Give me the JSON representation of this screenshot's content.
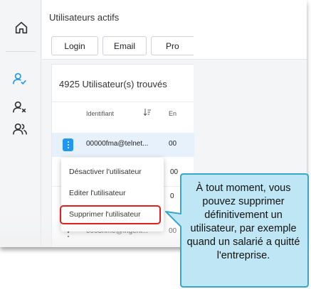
{
  "header": {
    "title": "Utilisateurs actifs",
    "buttons": {
      "login": "Login",
      "email": "Email",
      "pro": "Pro"
    }
  },
  "results": {
    "count_label": "4925 Utilisateur(s) trouvés"
  },
  "table": {
    "columns": {
      "identifiant": "Identifiant",
      "en": "En"
    },
    "rows": [
      {
        "id": "00000fma@telnet...",
        "col2": "00"
      },
      {
        "id": "",
        "col2": "00"
      },
      {
        "id": "",
        "col2": "0"
      },
      {
        "id": "0003hme@ingeni...",
        "col2": "00"
      }
    ]
  },
  "context_menu": {
    "deactivate": "Désactiver l'utilisateur",
    "edit": "Editer l'utilisateur",
    "delete": "Supprimer l'utilisateur"
  },
  "callout": {
    "text": "À tout moment, vous pouvez supprimer définitivement un utilisateur, par exemple quand un salarié a quitté l'entreprise."
  },
  "icons": {
    "home": "home-icon",
    "user_check": "user-check-icon",
    "user_remove": "user-remove-icon",
    "users": "users-icon",
    "sort": "sort-icon",
    "row_menu": "more-vertical-icon"
  },
  "colors": {
    "accent": "#2196f3",
    "selected_row": "#e7f1fb",
    "highlight_border": "#e0201f",
    "callout_fill": "#bfe6f4",
    "callout_border": "#39a6c9"
  }
}
